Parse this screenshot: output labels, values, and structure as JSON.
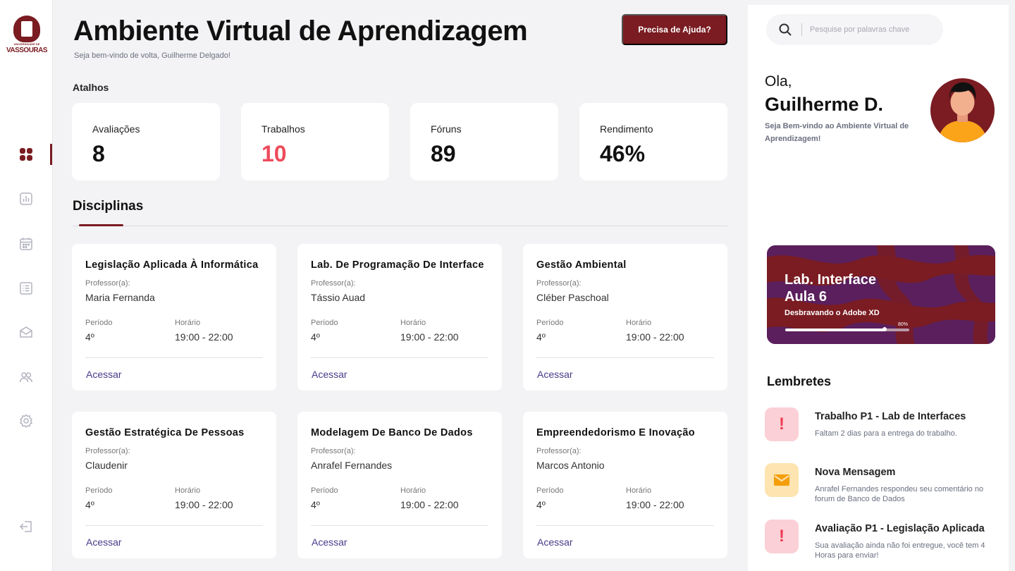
{
  "brand": {
    "line1": "UNIVERSIDADE DE",
    "line2": "VASSOURAS",
    "color": "#7a1c22"
  },
  "header": {
    "title": "Ambiente Virtual de Aprendizagem",
    "welcome": "Seja bem-vindo de volta, Guilherme Delgado!",
    "help_label": "Precisa de Ajuda?"
  },
  "shortcuts": {
    "label": "Atalhos",
    "items": [
      {
        "label": "Avaliações",
        "value": "8"
      },
      {
        "label": "Trabalhos",
        "value": "10"
      },
      {
        "label": "Fóruns",
        "value": "89"
      },
      {
        "label": "Rendimento",
        "value": "46%"
      }
    ]
  },
  "disciplines": {
    "title": "Disciplinas",
    "professor_label": "Professor(a):",
    "period_label": "Período",
    "schedule_label": "Horário",
    "access_label": "Acessar",
    "items": [
      {
        "name": "Legislação Aplicada À Informática",
        "professor": "Maria Fernanda",
        "period": "4º",
        "schedule": "19:00 - 22:00"
      },
      {
        "name": "Lab. De Programação De Interface",
        "professor": "Tássio Auad",
        "period": "4º",
        "schedule": "19:00 - 22:00"
      },
      {
        "name": "Gestão Ambiental",
        "professor": "Cléber Paschoal",
        "period": "4º",
        "schedule": "19:00 - 22:00"
      },
      {
        "name": "Gestão Estratégica De Pessoas",
        "professor": "Claudenir",
        "period": "4º",
        "schedule": "19:00 - 22:00"
      },
      {
        "name": "Modelagem De Banco De Dados",
        "professor": "Anrafel Fernandes",
        "period": "4º",
        "schedule": "19:00 - 22:00"
      },
      {
        "name": "Empreendedorismo E Inovação",
        "professor": "Marcos Antonio",
        "period": "4º",
        "schedule": "19:00 - 22:00"
      }
    ]
  },
  "sidebar": {
    "icons": [
      "dashboard-icon",
      "chart-icon",
      "calendar-icon",
      "list-icon",
      "mail-icon",
      "users-icon",
      "settings-icon",
      "logout-icon"
    ]
  },
  "search": {
    "placeholder": "Pesquise por palavras chave"
  },
  "profile": {
    "hello": "Ola,",
    "name": "Guilherme D.",
    "subtitle": "Seja Bem-vindo ao Ambiente Virtual de Aprendizagem!"
  },
  "promo": {
    "title_line1": "Lab. Interface",
    "title_line2": "Aula 6",
    "subtitle": "Desbravando o Adobe XD",
    "progress_label": "80%",
    "progress": 0.8
  },
  "reminders": {
    "title": "Lembretes",
    "items": [
      {
        "type": "alert",
        "title": "Trabalho P1 - Lab de Interfaces",
        "text": "Faltam 2 dias para a entrega do trabalho."
      },
      {
        "type": "mail",
        "title": "Nova Mensagem",
        "text": "Anrafel Fernandes respondeu seu comentário no forum de Banco de Dados"
      },
      {
        "type": "alert",
        "title": "Avaliação P1 - Legislação Aplicada",
        "text": "Sua avaliação ainda não foi entregue, você tem 4 Horas para enviar!"
      }
    ]
  },
  "colors": {
    "accent": "#7a1c22",
    "alert": "#ee4b5b",
    "link": "#4a3a8a"
  }
}
